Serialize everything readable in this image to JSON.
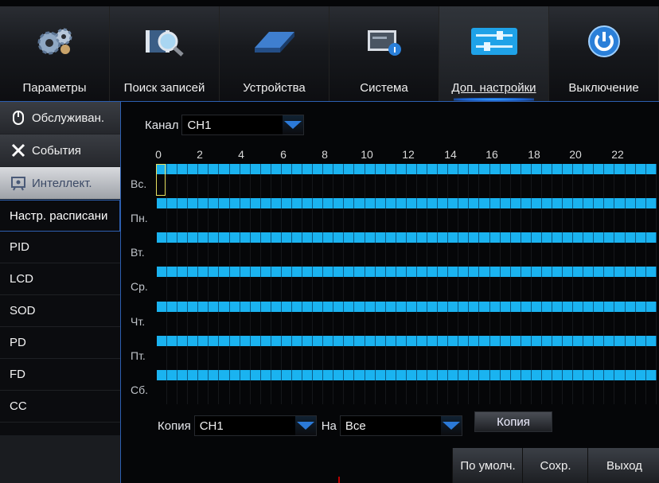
{
  "top_tabs": [
    {
      "label": "Параметры",
      "icon": "gears-icon"
    },
    {
      "label": "Поиск записей",
      "icon": "film-search-icon"
    },
    {
      "label": "Устройства",
      "icon": "hdd-icon"
    },
    {
      "label": "Система",
      "icon": "system-info-icon"
    },
    {
      "label": "Доп. настройки",
      "icon": "sliders-icon",
      "active": true
    },
    {
      "label": "Выключение",
      "icon": "power-icon"
    }
  ],
  "sidebar": {
    "sections": [
      {
        "label": "Обслуживан.",
        "icon": "mouse-icon"
      },
      {
        "label": "События",
        "icon": "tools-icon"
      },
      {
        "label": "Интеллект.",
        "icon": "intellect-icon",
        "active": true
      }
    ],
    "items": [
      "Настр. расписани",
      "PID",
      "LCD",
      "SOD",
      "PD",
      "FD",
      "CC"
    ],
    "selected_item": "Настр. расписани"
  },
  "channel": {
    "label": "Канал",
    "value": "CH1"
  },
  "hours": [
    "0",
    "2",
    "4",
    "6",
    "8",
    "10",
    "12",
    "14",
    "16",
    "18",
    "20",
    "22"
  ],
  "days": [
    "Вс.",
    "Пн.",
    "Вт.",
    "Ср.",
    "Чт.",
    "Пт.",
    "Сб."
  ],
  "copy": {
    "label": "Копия",
    "value": "CH1",
    "to_label": "На",
    "to_value": "Все",
    "button": "Копия"
  },
  "footer": {
    "default": "По умолч.",
    "save": "Сохр.",
    "exit": "Выход"
  },
  "colors": {
    "accent": "#2d5fb0",
    "schedule": "#1ab3f0"
  }
}
